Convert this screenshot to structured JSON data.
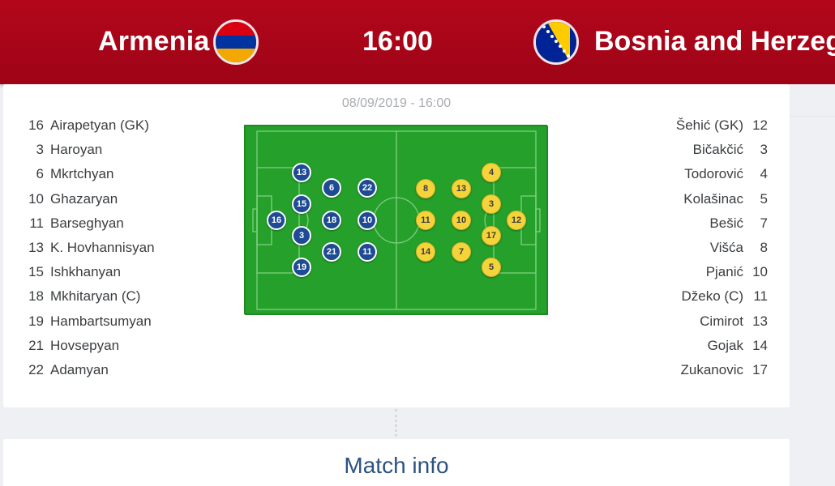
{
  "header": {
    "home_team": "Armenia",
    "away_team": "Bosnia and Herzego",
    "kickoff": "16:00"
  },
  "match": {
    "date_time": "08/09/2019 - 16:00"
  },
  "home_lineup": [
    {
      "num": "16",
      "name": "Airapetyan (GK)"
    },
    {
      "num": "3",
      "name": "Haroyan"
    },
    {
      "num": "6",
      "name": "Mkrtchyan"
    },
    {
      "num": "10",
      "name": "Ghazaryan"
    },
    {
      "num": "11",
      "name": "Barseghyan"
    },
    {
      "num": "13",
      "name": "K. Hovhannisyan"
    },
    {
      "num": "15",
      "name": "Ishkhanyan"
    },
    {
      "num": "18",
      "name": "Mkhitaryan (C)"
    },
    {
      "num": "19",
      "name": "Hambartsumyan"
    },
    {
      "num": "21",
      "name": "Hovsepyan"
    },
    {
      "num": "22",
      "name": "Adamyan"
    }
  ],
  "away_lineup": [
    {
      "num": "12",
      "name": "Šehić (GK)"
    },
    {
      "num": "3",
      "name": "Bičakčić"
    },
    {
      "num": "4",
      "name": "Todorović"
    },
    {
      "num": "5",
      "name": "Kolašinac"
    },
    {
      "num": "7",
      "name": "Bešić"
    },
    {
      "num": "8",
      "name": "Višća"
    },
    {
      "num": "10",
      "name": "Pjanić"
    },
    {
      "num": "11",
      "name": "Džeko (C)"
    },
    {
      "num": "13",
      "name": "Cimirot"
    },
    {
      "num": "14",
      "name": "Gojak"
    },
    {
      "num": "17",
      "name": "Zukanovic"
    }
  ],
  "pitch_home": [
    "13",
    "6",
    "22",
    "15",
    "16",
    "18",
    "10",
    "3",
    "21",
    "11",
    "19"
  ],
  "pitch_away": [
    "8",
    "13",
    "4",
    "3",
    "11",
    "10",
    "12",
    "17",
    "14",
    "7",
    "5"
  ],
  "match_info": {
    "title": "Match info"
  },
  "colors": {
    "header_red": "#a8051a",
    "pitch_green": "#25a02a",
    "home_chip": "#1e4b93",
    "away_chip": "#f5d33a",
    "info_title": "#2c5380"
  }
}
